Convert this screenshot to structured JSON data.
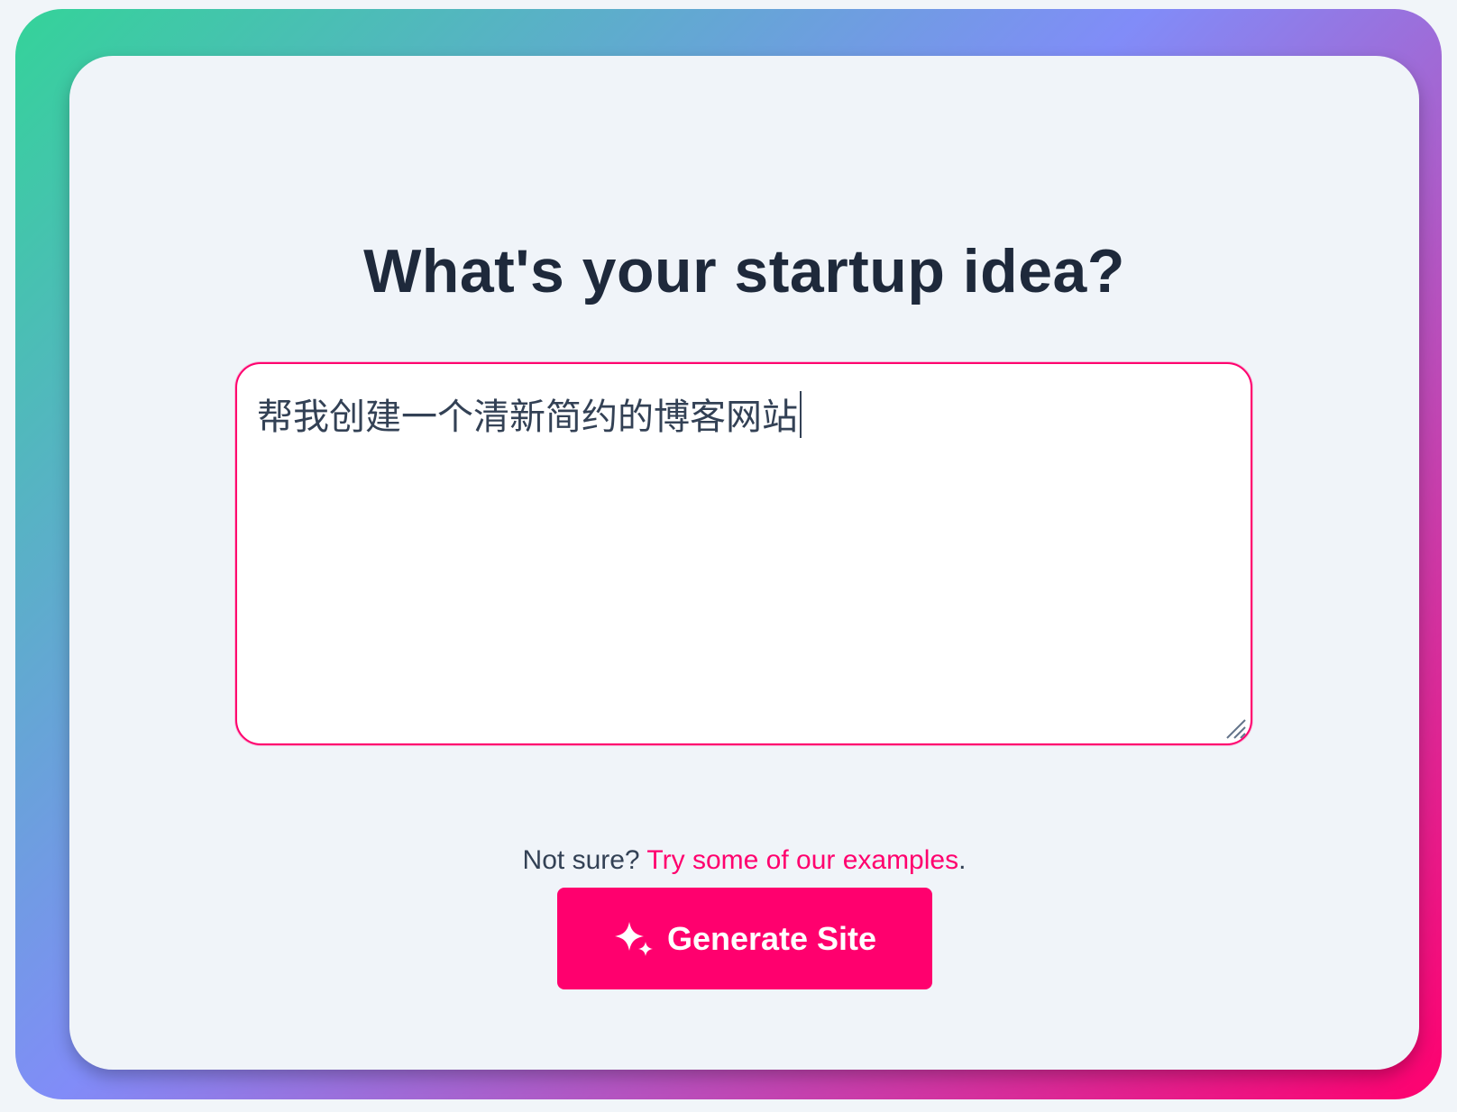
{
  "page": {
    "title": "What's your startup idea?"
  },
  "idea_input": {
    "value": "帮我创建一个清新简约的博客网站"
  },
  "hint": {
    "prefix": "Not sure?",
    "link": "Try some of our examples",
    "suffix": "."
  },
  "generate_button": {
    "label": "Generate Site",
    "icon": "sparkles-icon"
  },
  "colors": {
    "accent": "#ff006e",
    "gradient_start": "#34d399",
    "gradient_mid": "#818cf8",
    "gradient_end": "#ff006e",
    "heading": "#1e293b",
    "card_bg": "#f0f4f9"
  }
}
